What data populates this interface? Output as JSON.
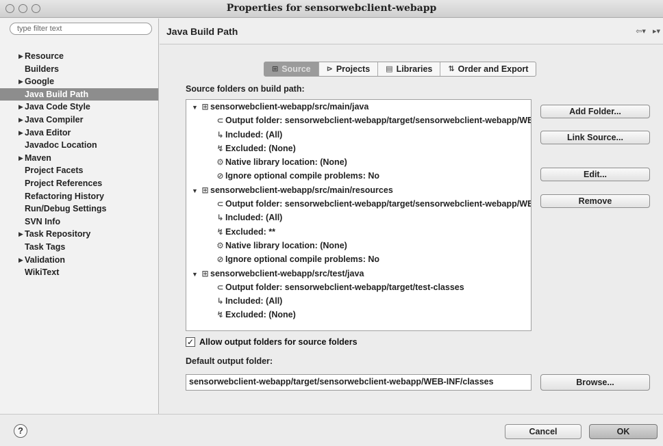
{
  "window": {
    "title": "Properties for sensorwebclient-webapp"
  },
  "filter": {
    "placeholder": "type filter text"
  },
  "nav": {
    "items": [
      {
        "label": "Resource",
        "expandable": true
      },
      {
        "label": "Builders",
        "expandable": false
      },
      {
        "label": "Google",
        "expandable": true
      },
      {
        "label": "Java Build Path",
        "expandable": false,
        "selected": true
      },
      {
        "label": "Java Code Style",
        "expandable": true
      },
      {
        "label": "Java Compiler",
        "expandable": true
      },
      {
        "label": "Java Editor",
        "expandable": true
      },
      {
        "label": "Javadoc Location",
        "expandable": false
      },
      {
        "label": "Maven",
        "expandable": true
      },
      {
        "label": "Project Facets",
        "expandable": false
      },
      {
        "label": "Project References",
        "expandable": false
      },
      {
        "label": "Refactoring History",
        "expandable": false
      },
      {
        "label": "Run/Debug Settings",
        "expandable": false
      },
      {
        "label": "SVN Info",
        "expandable": false
      },
      {
        "label": "Task Repository",
        "expandable": true
      },
      {
        "label": "Task Tags",
        "expandable": false
      },
      {
        "label": "Validation",
        "expandable": true
      },
      {
        "label": "WikiText",
        "expandable": false
      }
    ]
  },
  "page": {
    "title": "Java Build Path"
  },
  "tabs": [
    {
      "label": "Source",
      "icon": "source-folder-icon",
      "active": true
    },
    {
      "label": "Projects",
      "icon": "project-icon",
      "active": false
    },
    {
      "label": "Libraries",
      "icon": "library-icon",
      "active": false
    },
    {
      "label": "Order and Export",
      "icon": "order-icon",
      "active": false
    }
  ],
  "source": {
    "label": "Source folders on build path:",
    "tree": [
      {
        "level": 0,
        "expanded": true,
        "icon": "source-folder-icon",
        "text": "sensorwebclient-webapp/src/main/java"
      },
      {
        "level": 1,
        "icon": "output-folder-icon",
        "text": "Output folder: sensorwebclient-webapp/target/sensorwebclient-webapp/WEB-INF/classes"
      },
      {
        "level": 1,
        "icon": "included-icon",
        "text": "Included: (All)"
      },
      {
        "level": 1,
        "icon": "excluded-icon",
        "text": "Excluded: (None)"
      },
      {
        "level": 1,
        "icon": "native-library-icon",
        "text": "Native library location: (None)"
      },
      {
        "level": 1,
        "icon": "ignore-problems-icon",
        "text": "Ignore optional compile problems: No"
      },
      {
        "level": 0,
        "expanded": true,
        "icon": "source-folder-icon",
        "text": "sensorwebclient-webapp/src/main/resources"
      },
      {
        "level": 1,
        "icon": "output-folder-icon",
        "text": "Output folder: sensorwebclient-webapp/target/sensorwebclient-webapp/WEB-INF/classes"
      },
      {
        "level": 1,
        "icon": "included-icon",
        "text": "Included: (All)"
      },
      {
        "level": 1,
        "icon": "excluded-icon",
        "text": "Excluded: **"
      },
      {
        "level": 1,
        "icon": "native-library-icon",
        "text": "Native library location: (None)"
      },
      {
        "level": 1,
        "icon": "ignore-problems-icon",
        "text": "Ignore optional compile problems: No"
      },
      {
        "level": 0,
        "expanded": true,
        "icon": "source-folder-icon",
        "text": "sensorwebclient-webapp/src/test/java"
      },
      {
        "level": 1,
        "icon": "output-folder-icon",
        "text": "Output folder: sensorwebclient-webapp/target/test-classes"
      },
      {
        "level": 1,
        "icon": "included-icon",
        "text": "Included: (All)"
      },
      {
        "level": 1,
        "icon": "excluded-icon",
        "text": "Excluded: (None)"
      }
    ],
    "buttons": {
      "add_folder": "Add Folder...",
      "link_source": "Link Source...",
      "edit": "Edit...",
      "remove": "Remove"
    },
    "allow_output_label": "Allow output folders for source folders",
    "allow_output_checked": true,
    "default_output_label": "Default output folder:",
    "default_output_value": "sensorwebclient-webapp/target/sensorwebclient-webapp/WEB-INF/classes",
    "browse_label": "Browse..."
  },
  "footer": {
    "help": "?",
    "cancel": "Cancel",
    "ok": "OK"
  }
}
